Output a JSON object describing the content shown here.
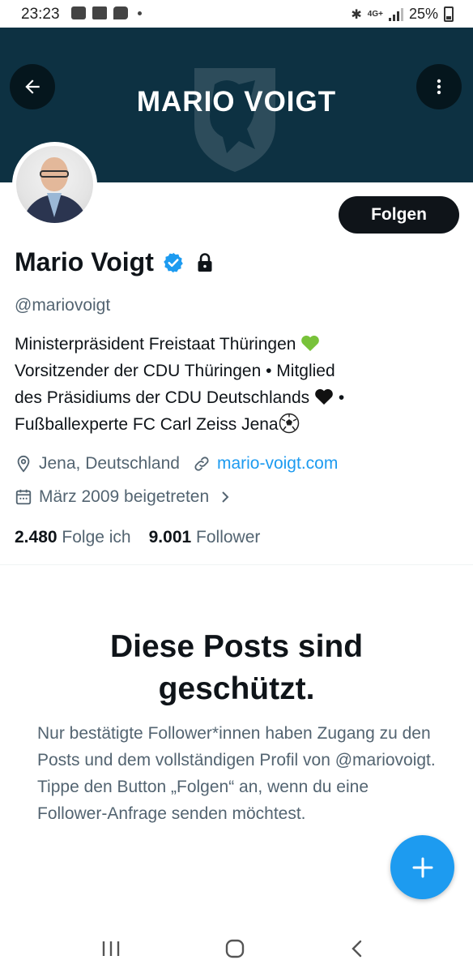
{
  "status_bar": {
    "time": "23:23",
    "network": "4G+",
    "battery": "25%"
  },
  "banner": {
    "title": "MARIO VOIGT",
    "color": "#0d3142"
  },
  "profile": {
    "follow_label": "Folgen",
    "name": "Mario Voigt",
    "handle": "@mariovoigt",
    "bio_line1": "Ministerpräsident Freistaat Thüringen",
    "bio_line2": "Vorsitzender der CDU Thüringen • Mitglied",
    "bio_line3": "des Präsidiums der CDU Deutschlands",
    "bio_line3_suffix": " •",
    "bio_line4": "Fußballexperte FC Carl Zeiss Jena",
    "location": "Jena, Deutschland",
    "website": "mario-voigt.com",
    "joined": "März 2009 beigetreten",
    "following_count": "2.480",
    "following_label": "Folge ich",
    "followers_count": "9.001",
    "followers_label": "Follower"
  },
  "protected": {
    "title_line1": "Diese Posts sind",
    "title_line2": "geschützt.",
    "text": "Nur bestätigte Follower*innen haben Zugang zu den Posts und dem vollständigen Profil von @mariovoigt. Tippe den Button „Folgen“ an, wenn du eine Follower-Anfrage senden möchtest."
  },
  "icons": {
    "back": "arrow-left-icon",
    "more": "more-vertical-icon",
    "verified": "verified-badge-icon",
    "lock": "lock-icon",
    "location": "location-pin-icon",
    "link": "link-icon",
    "calendar": "calendar-icon",
    "chevron": "chevron-right-icon",
    "fab": "plus-icon",
    "nav_recent": "recent-apps-icon",
    "nav_home": "home-icon",
    "nav_back": "back-nav-icon"
  },
  "colors": {
    "accent": "#1d9bf0",
    "text_primary": "#0f1419",
    "text_secondary": "#536471",
    "button_dark": "#0f1419"
  }
}
